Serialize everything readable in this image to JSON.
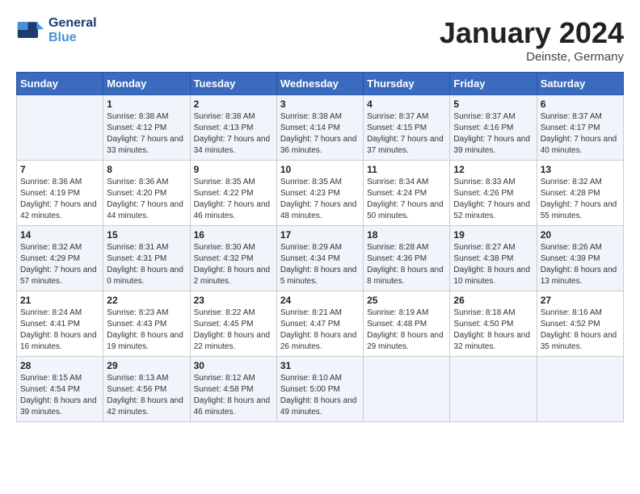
{
  "header": {
    "logo_line1": "General",
    "logo_line2": "Blue",
    "month_title": "January 2024",
    "location": "Deinste, Germany"
  },
  "days_of_week": [
    "Sunday",
    "Monday",
    "Tuesday",
    "Wednesday",
    "Thursday",
    "Friday",
    "Saturday"
  ],
  "weeks": [
    [
      {
        "day": "",
        "sunrise": "",
        "sunset": "",
        "daylight": ""
      },
      {
        "day": "1",
        "sunrise": "Sunrise: 8:38 AM",
        "sunset": "Sunset: 4:12 PM",
        "daylight": "Daylight: 7 hours and 33 minutes."
      },
      {
        "day": "2",
        "sunrise": "Sunrise: 8:38 AM",
        "sunset": "Sunset: 4:13 PM",
        "daylight": "Daylight: 7 hours and 34 minutes."
      },
      {
        "day": "3",
        "sunrise": "Sunrise: 8:38 AM",
        "sunset": "Sunset: 4:14 PM",
        "daylight": "Daylight: 7 hours and 36 minutes."
      },
      {
        "day": "4",
        "sunrise": "Sunrise: 8:37 AM",
        "sunset": "Sunset: 4:15 PM",
        "daylight": "Daylight: 7 hours and 37 minutes."
      },
      {
        "day": "5",
        "sunrise": "Sunrise: 8:37 AM",
        "sunset": "Sunset: 4:16 PM",
        "daylight": "Daylight: 7 hours and 39 minutes."
      },
      {
        "day": "6",
        "sunrise": "Sunrise: 8:37 AM",
        "sunset": "Sunset: 4:17 PM",
        "daylight": "Daylight: 7 hours and 40 minutes."
      }
    ],
    [
      {
        "day": "7",
        "sunrise": "Sunrise: 8:36 AM",
        "sunset": "Sunset: 4:19 PM",
        "daylight": "Daylight: 7 hours and 42 minutes."
      },
      {
        "day": "8",
        "sunrise": "Sunrise: 8:36 AM",
        "sunset": "Sunset: 4:20 PM",
        "daylight": "Daylight: 7 hours and 44 minutes."
      },
      {
        "day": "9",
        "sunrise": "Sunrise: 8:35 AM",
        "sunset": "Sunset: 4:22 PM",
        "daylight": "Daylight: 7 hours and 46 minutes."
      },
      {
        "day": "10",
        "sunrise": "Sunrise: 8:35 AM",
        "sunset": "Sunset: 4:23 PM",
        "daylight": "Daylight: 7 hours and 48 minutes."
      },
      {
        "day": "11",
        "sunrise": "Sunrise: 8:34 AM",
        "sunset": "Sunset: 4:24 PM",
        "daylight": "Daylight: 7 hours and 50 minutes."
      },
      {
        "day": "12",
        "sunrise": "Sunrise: 8:33 AM",
        "sunset": "Sunset: 4:26 PM",
        "daylight": "Daylight: 7 hours and 52 minutes."
      },
      {
        "day": "13",
        "sunrise": "Sunrise: 8:32 AM",
        "sunset": "Sunset: 4:28 PM",
        "daylight": "Daylight: 7 hours and 55 minutes."
      }
    ],
    [
      {
        "day": "14",
        "sunrise": "Sunrise: 8:32 AM",
        "sunset": "Sunset: 4:29 PM",
        "daylight": "Daylight: 7 hours and 57 minutes."
      },
      {
        "day": "15",
        "sunrise": "Sunrise: 8:31 AM",
        "sunset": "Sunset: 4:31 PM",
        "daylight": "Daylight: 8 hours and 0 minutes."
      },
      {
        "day": "16",
        "sunrise": "Sunrise: 8:30 AM",
        "sunset": "Sunset: 4:32 PM",
        "daylight": "Daylight: 8 hours and 2 minutes."
      },
      {
        "day": "17",
        "sunrise": "Sunrise: 8:29 AM",
        "sunset": "Sunset: 4:34 PM",
        "daylight": "Daylight: 8 hours and 5 minutes."
      },
      {
        "day": "18",
        "sunrise": "Sunrise: 8:28 AM",
        "sunset": "Sunset: 4:36 PM",
        "daylight": "Daylight: 8 hours and 8 minutes."
      },
      {
        "day": "19",
        "sunrise": "Sunrise: 8:27 AM",
        "sunset": "Sunset: 4:38 PM",
        "daylight": "Daylight: 8 hours and 10 minutes."
      },
      {
        "day": "20",
        "sunrise": "Sunrise: 8:26 AM",
        "sunset": "Sunset: 4:39 PM",
        "daylight": "Daylight: 8 hours and 13 minutes."
      }
    ],
    [
      {
        "day": "21",
        "sunrise": "Sunrise: 8:24 AM",
        "sunset": "Sunset: 4:41 PM",
        "daylight": "Daylight: 8 hours and 16 minutes."
      },
      {
        "day": "22",
        "sunrise": "Sunrise: 8:23 AM",
        "sunset": "Sunset: 4:43 PM",
        "daylight": "Daylight: 8 hours and 19 minutes."
      },
      {
        "day": "23",
        "sunrise": "Sunrise: 8:22 AM",
        "sunset": "Sunset: 4:45 PM",
        "daylight": "Daylight: 8 hours and 22 minutes."
      },
      {
        "day": "24",
        "sunrise": "Sunrise: 8:21 AM",
        "sunset": "Sunset: 4:47 PM",
        "daylight": "Daylight: 8 hours and 26 minutes."
      },
      {
        "day": "25",
        "sunrise": "Sunrise: 8:19 AM",
        "sunset": "Sunset: 4:48 PM",
        "daylight": "Daylight: 8 hours and 29 minutes."
      },
      {
        "day": "26",
        "sunrise": "Sunrise: 8:18 AM",
        "sunset": "Sunset: 4:50 PM",
        "daylight": "Daylight: 8 hours and 32 minutes."
      },
      {
        "day": "27",
        "sunrise": "Sunrise: 8:16 AM",
        "sunset": "Sunset: 4:52 PM",
        "daylight": "Daylight: 8 hours and 35 minutes."
      }
    ],
    [
      {
        "day": "28",
        "sunrise": "Sunrise: 8:15 AM",
        "sunset": "Sunset: 4:54 PM",
        "daylight": "Daylight: 8 hours and 39 minutes."
      },
      {
        "day": "29",
        "sunrise": "Sunrise: 8:13 AM",
        "sunset": "Sunset: 4:56 PM",
        "daylight": "Daylight: 8 hours and 42 minutes."
      },
      {
        "day": "30",
        "sunrise": "Sunrise: 8:12 AM",
        "sunset": "Sunset: 4:58 PM",
        "daylight": "Daylight: 8 hours and 46 minutes."
      },
      {
        "day": "31",
        "sunrise": "Sunrise: 8:10 AM",
        "sunset": "Sunset: 5:00 PM",
        "daylight": "Daylight: 8 hours and 49 minutes."
      },
      {
        "day": "",
        "sunrise": "",
        "sunset": "",
        "daylight": ""
      },
      {
        "day": "",
        "sunrise": "",
        "sunset": "",
        "daylight": ""
      },
      {
        "day": "",
        "sunrise": "",
        "sunset": "",
        "daylight": ""
      }
    ]
  ]
}
